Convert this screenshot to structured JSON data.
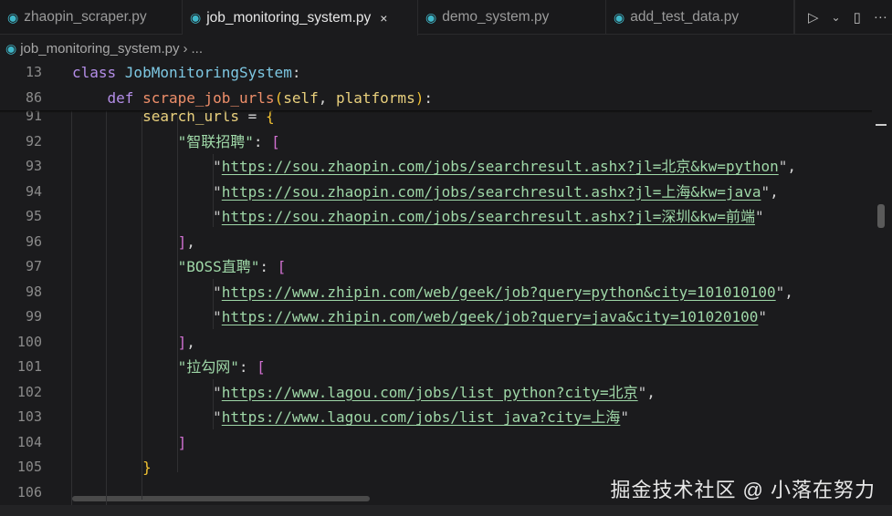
{
  "tabs": [
    {
      "label": "zhaopin_scraper.py",
      "active": false
    },
    {
      "label": "job_monitoring_system.py",
      "active": true
    },
    {
      "label": "demo_system.py",
      "active": false
    },
    {
      "label": "add_test_data.py",
      "active": false
    }
  ],
  "icons": {
    "python": "python-file-icon",
    "close": "×",
    "run": "▷",
    "chevron": "⌄",
    "split": "▯",
    "more": "···"
  },
  "breadcrumb": {
    "file": "job_monitoring_system.py",
    "sep": "›",
    "more": "..."
  },
  "sticky": [
    {
      "n": "13",
      "tokens": [
        {
          "t": "class ",
          "c": "kw"
        },
        {
          "t": "JobMonitoringSystem",
          "c": "cls"
        },
        {
          "t": ":",
          "c": "pun"
        }
      ]
    },
    {
      "n": "86",
      "tokens": [
        {
          "t": "    "
        },
        {
          "t": "def ",
          "c": "kw"
        },
        {
          "t": "scrape_job_urls",
          "c": "fn"
        },
        {
          "t": "(",
          "c": "brY"
        },
        {
          "t": "self",
          "c": "prm"
        },
        {
          "t": ", ",
          "c": "pun"
        },
        {
          "t": "platforms",
          "c": "prm"
        },
        {
          "t": ")",
          "c": "brY"
        },
        {
          "t": ":",
          "c": "pun"
        }
      ]
    }
  ],
  "lines": [
    {
      "n": "91",
      "tokens": [
        {
          "t": "        "
        },
        {
          "t": "search_urls",
          "c": "var"
        },
        {
          "t": " = ",
          "c": "pun"
        },
        {
          "t": "{",
          "c": "brY"
        }
      ]
    },
    {
      "n": "92",
      "tokens": [
        {
          "t": "            "
        },
        {
          "t": "\"智联招聘\"",
          "c": "str"
        },
        {
          "t": ": ",
          "c": "pun"
        },
        {
          "t": "[",
          "c": "brP"
        }
      ]
    },
    {
      "n": "93",
      "tokens": [
        {
          "t": "                "
        },
        {
          "t": "\"",
          "c": "q"
        },
        {
          "t": "https://sou.zhaopin.com/jobs/searchresult.ashx?jl=北京&kw=python",
          "c": "url"
        },
        {
          "t": "\"",
          "c": "q"
        },
        {
          "t": ",",
          "c": "pun"
        }
      ]
    },
    {
      "n": "94",
      "tokens": [
        {
          "t": "                "
        },
        {
          "t": "\"",
          "c": "q"
        },
        {
          "t": "https://sou.zhaopin.com/jobs/searchresult.ashx?jl=上海&kw=java",
          "c": "url"
        },
        {
          "t": "\"",
          "c": "q"
        },
        {
          "t": ",",
          "c": "pun"
        }
      ]
    },
    {
      "n": "95",
      "tokens": [
        {
          "t": "                "
        },
        {
          "t": "\"",
          "c": "q"
        },
        {
          "t": "https://sou.zhaopin.com/jobs/searchresult.ashx?jl=深圳&kw=前端",
          "c": "url"
        },
        {
          "t": "\"",
          "c": "q"
        }
      ]
    },
    {
      "n": "96",
      "tokens": [
        {
          "t": "            "
        },
        {
          "t": "]",
          "c": "brP"
        },
        {
          "t": ",",
          "c": "pun"
        }
      ]
    },
    {
      "n": "97",
      "tokens": [
        {
          "t": "            "
        },
        {
          "t": "\"BOSS直聘\"",
          "c": "str"
        },
        {
          "t": ": ",
          "c": "pun"
        },
        {
          "t": "[",
          "c": "brP"
        }
      ]
    },
    {
      "n": "98",
      "tokens": [
        {
          "t": "                "
        },
        {
          "t": "\"",
          "c": "q"
        },
        {
          "t": "https://www.zhipin.com/web/geek/job?query=python&city=101010100",
          "c": "url"
        },
        {
          "t": "\"",
          "c": "q"
        },
        {
          "t": ",",
          "c": "pun"
        }
      ]
    },
    {
      "n": "99",
      "tokens": [
        {
          "t": "                "
        },
        {
          "t": "\"",
          "c": "q"
        },
        {
          "t": "https://www.zhipin.com/web/geek/job?query=java&city=101020100",
          "c": "url"
        },
        {
          "t": "\"",
          "c": "q"
        }
      ]
    },
    {
      "n": "100",
      "tokens": [
        {
          "t": "            "
        },
        {
          "t": "]",
          "c": "brP"
        },
        {
          "t": ",",
          "c": "pun"
        }
      ]
    },
    {
      "n": "101",
      "tokens": [
        {
          "t": "            "
        },
        {
          "t": "\"拉勾网\"",
          "c": "str"
        },
        {
          "t": ": ",
          "c": "pun"
        },
        {
          "t": "[",
          "c": "brP"
        }
      ]
    },
    {
      "n": "102",
      "tokens": [
        {
          "t": "                "
        },
        {
          "t": "\"",
          "c": "q"
        },
        {
          "t": "https://www.lagou.com/jobs/list_python?city=北京",
          "c": "url"
        },
        {
          "t": "\"",
          "c": "q"
        },
        {
          "t": ",",
          "c": "pun"
        }
      ]
    },
    {
      "n": "103",
      "tokens": [
        {
          "t": "                "
        },
        {
          "t": "\"",
          "c": "q"
        },
        {
          "t": "https://www.lagou.com/jobs/list_java?city=上海",
          "c": "url"
        },
        {
          "t": "\"",
          "c": "q"
        }
      ]
    },
    {
      "n": "104",
      "tokens": [
        {
          "t": "            "
        },
        {
          "t": "]",
          "c": "brP"
        }
      ]
    },
    {
      "n": "105",
      "tokens": [
        {
          "t": "        "
        },
        {
          "t": "}",
          "c": "brY"
        }
      ]
    },
    {
      "n": "106",
      "tokens": []
    }
  ],
  "watermark": "掘金技术社区 @ 小落在努力"
}
